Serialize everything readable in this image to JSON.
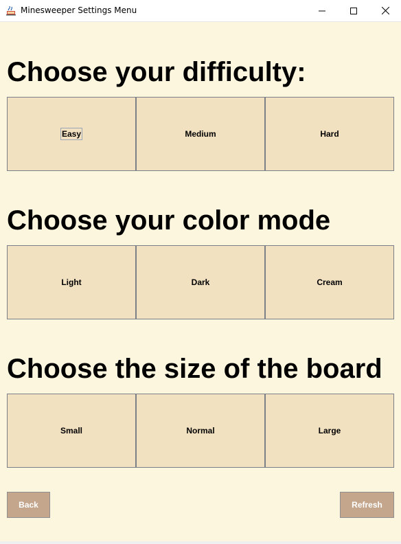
{
  "window": {
    "title": "Minesweeper Settings Menu",
    "controls": [
      "minimize",
      "maximize",
      "close"
    ]
  },
  "difficulty": {
    "heading": "Choose your difficulty:",
    "options": [
      "Easy",
      "Medium",
      "Hard"
    ],
    "focused": "Easy"
  },
  "color_mode": {
    "heading": "Choose your color mode",
    "options": [
      "Light",
      "Dark",
      "Cream"
    ]
  },
  "board_size": {
    "heading": "Choose the size of the board",
    "options": [
      "Small",
      "Normal",
      "Large"
    ]
  },
  "footer": {
    "back_label": "Back",
    "refresh_label": "Refresh"
  },
  "colors": {
    "background": "#fdf6de",
    "option_button": "#f2e1c0",
    "footer_button": "#c4a68c",
    "border": "#7a8088"
  },
  "icons": {
    "app": "java-app-icon",
    "minimize": "minimize-icon",
    "maximize": "maximize-icon",
    "close": "close-icon"
  }
}
